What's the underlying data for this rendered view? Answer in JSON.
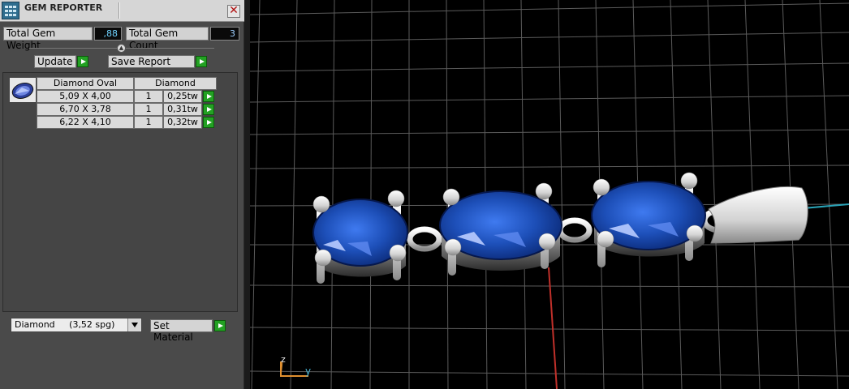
{
  "window": {
    "title": "GEM REPORTER",
    "close_glyph": "✕"
  },
  "summary": {
    "weight_label": "Total Gem Weight",
    "weight_value": ",88",
    "count_label": "Total Gem Count",
    "count_value": "3"
  },
  "actions": {
    "update_label": "Update",
    "save_label": "Save Report"
  },
  "gem_table": {
    "headers": [
      "Diamond Oval",
      "Diamond"
    ],
    "rows": [
      {
        "size": "5,09 X 4,00",
        "qty": "1",
        "weight": "0,25tw"
      },
      {
        "size": "6,70 X 3,78",
        "qty": "1",
        "weight": "0,31tw"
      },
      {
        "size": "6,22 X 4,10",
        "qty": "1",
        "weight": "0,32tw"
      }
    ]
  },
  "material": {
    "selected": "Diamond     (3,52 spg)",
    "set_label": "Set Material"
  },
  "viewport": {
    "axis_z": "z",
    "axis_y": "y"
  },
  "colors": {
    "accent_green": "#23a123",
    "value_cyan": "#6fd3ff",
    "gem_blue": "#1d4fb8",
    "viewport_bg": "#000000"
  },
  "icons": [
    "app-logo-icon",
    "close-icon",
    "play-arrow-icon",
    "gem-oval-icon",
    "dropdown-arrow-icon"
  ]
}
